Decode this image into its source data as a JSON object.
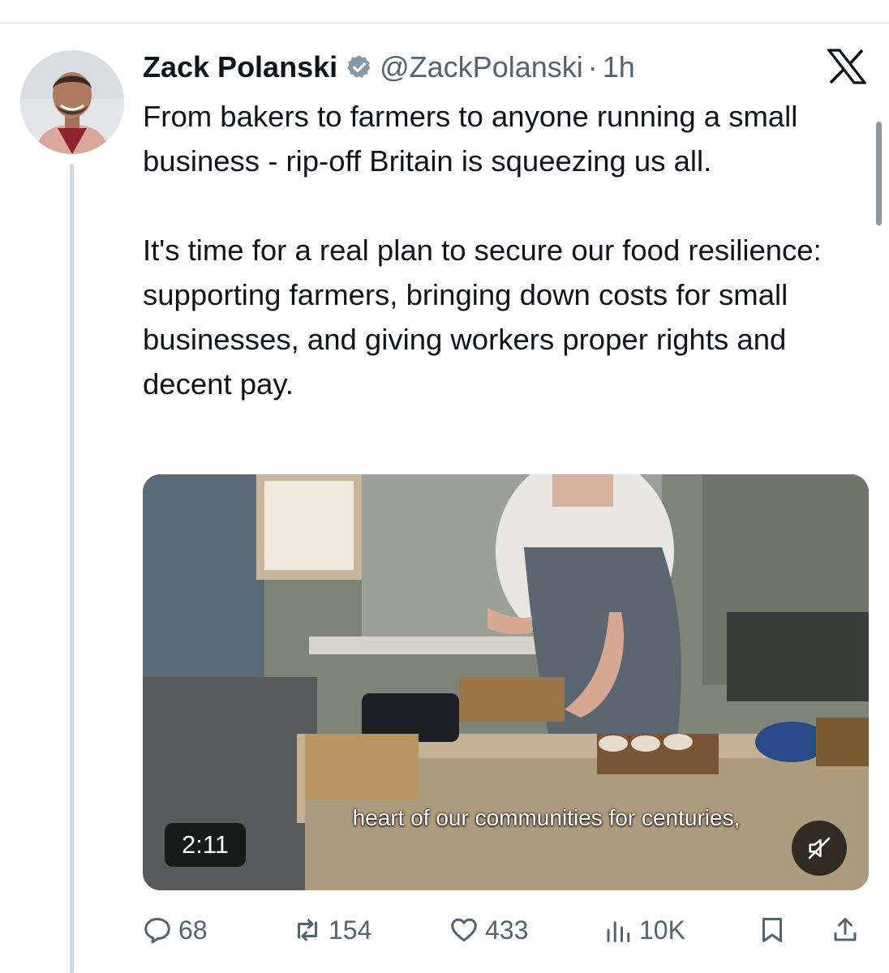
{
  "tweet": {
    "author_name": "Zack Polanski",
    "handle": "@ZackPolanski",
    "separator": "·",
    "time": "1h",
    "text_paragraph_1": "From bakers to farmers to anyone running a small business - rip-off Britain is squeezing us all.",
    "text_paragraph_2": "It's time for a real plan to secure our food resilience: supporting farmers, bringing down costs for small businesses, and giving workers proper rights and decent pay."
  },
  "media": {
    "subtitle": "heart of our communities for centuries,",
    "duration": "2:11",
    "mute_icon": "speaker-muted-icon"
  },
  "actions": {
    "replies": "68",
    "reposts": "154",
    "likes": "433",
    "views": "10K",
    "reply_icon": "reply-icon",
    "repost_icon": "repost-icon",
    "like_icon": "heart-icon",
    "views_icon": "bar-chart-icon",
    "bookmark_icon": "bookmark-icon",
    "share_icon": "share-icon"
  },
  "colors": {
    "text_primary": "#0f1419",
    "text_secondary": "#536471",
    "verified_badge": "#829aab",
    "thread_line": "#cfd9de"
  }
}
